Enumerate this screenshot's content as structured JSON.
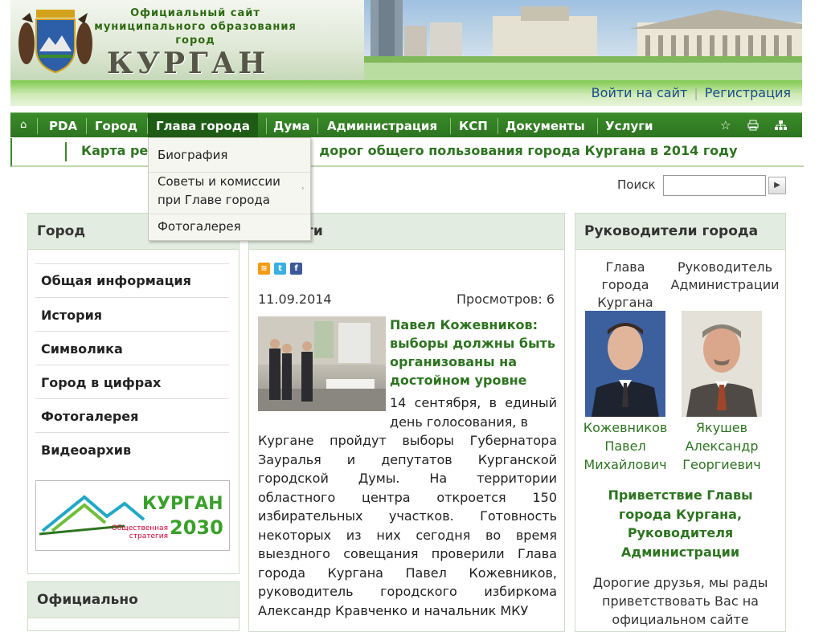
{
  "header": {
    "site_title_lines": [
      "Официальный сайт",
      "муниципального образования",
      "город"
    ],
    "city_name": "КУРГАН"
  },
  "user_links": {
    "login": "Войти на сайт",
    "register": "Регистрация"
  },
  "nav": {
    "home_icon": "home-icon",
    "items": [
      "PDA",
      "Город",
      "Глава города",
      "Дума",
      "Администрация",
      "КСП",
      "Документы",
      "Услуги"
    ],
    "active": "Глава города",
    "right_icons": [
      "star-icon",
      "print-icon",
      "sitemap-icon"
    ]
  },
  "dropdown": {
    "items": [
      "Биография",
      "Советы и комиссии",
      "при Главе города",
      "Фотогалерея"
    ]
  },
  "ticker": {
    "prefix": "Карта ре",
    "suffix": "дорог общего пользования города Кургана в 2014 году"
  },
  "search": {
    "label": "Поиск",
    "value": ""
  },
  "left_panel": {
    "title": "Город",
    "items": [
      "Общая информация",
      "История",
      "Символика",
      "Город в цифрах",
      "Фотогалерея",
      "Видеоархив"
    ],
    "banner": {
      "name": "КУРГАН",
      "line1": "Общественная",
      "line2": "стратегия",
      "year": "2030"
    },
    "second_title": "Официально"
  },
  "center_panel": {
    "title_suffix": "ти",
    "date": "11.09.2014",
    "views": "Просмотров: 6",
    "news_title": "Павел Кожевников: выборы должны быть организованы на достойном уровне",
    "news_lead": "14 сентября, в единый день голосования, в",
    "news_body": "Кургане пройдут выборы Губернатора Зауралья и депутатов Курганской городской Думы. На территории областного центра откроется 150 избирательных участков. Готовность некоторых из них сегодня во время выездного совещания проверили Глава города Кургана Павел Кожевников, руководитель городского избиркома Александр Кравченко и начальник МКУ"
  },
  "right_panel": {
    "title": "Руководители города",
    "leader1_caption": [
      "Глава",
      "города",
      "Кургана"
    ],
    "leader2_caption": [
      "Руководитель",
      "Администрации"
    ],
    "leader1_name": [
      "Кожевников",
      "Павел",
      "Михайлович"
    ],
    "leader2_name": [
      "Якушев",
      "Александр",
      "Георгиевич"
    ],
    "greeting_title": "Приветствие Главы города Кургана, Руководителя Администрации",
    "greeting_text": "Дорогие друзья, мы рады приветствовать Вас на официальном сайте"
  },
  "colors": {
    "brand_green": "#2d7420",
    "nav_green": "#3b8b2a",
    "link_blue": "#1a4a8c"
  }
}
